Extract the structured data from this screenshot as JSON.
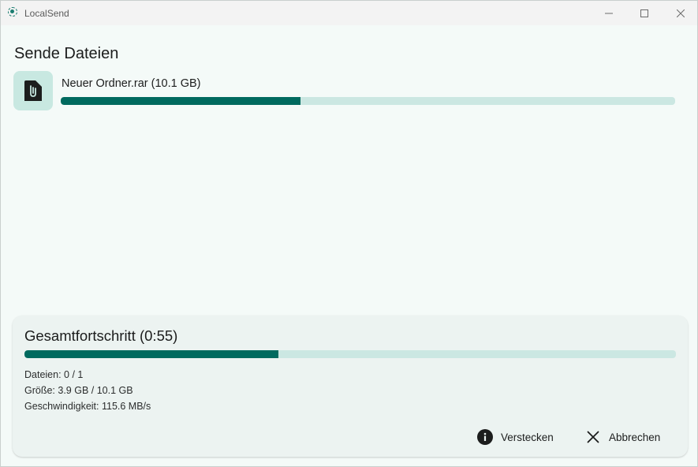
{
  "window": {
    "app_title": "LocalSend"
  },
  "page": {
    "title": "Sende Dateien"
  },
  "file": {
    "name_label": "Neuer Ordner.rar (10.1 GB)",
    "progress": 0.39
  },
  "summary": {
    "title": "Gesamtfortschritt (0:55)",
    "progress": 0.39,
    "files_line": "Dateien: 0 / 1",
    "size_line": "Größe: 3.9 GB / 10.1 GB",
    "speed_line": "Geschwindigkeit: 115.6 MB/s"
  },
  "actions": {
    "hide_label": "Verstecken",
    "cancel_label": "Abbrechen"
  },
  "icons": {
    "app": "localsend-logo-icon",
    "file": "file-attachment-icon",
    "hide": "info-icon",
    "cancel": "close-icon"
  },
  "colors": {
    "accent": "#006a5f",
    "track": "#cbe7e2",
    "icon_bg": "#c8e8e1"
  }
}
